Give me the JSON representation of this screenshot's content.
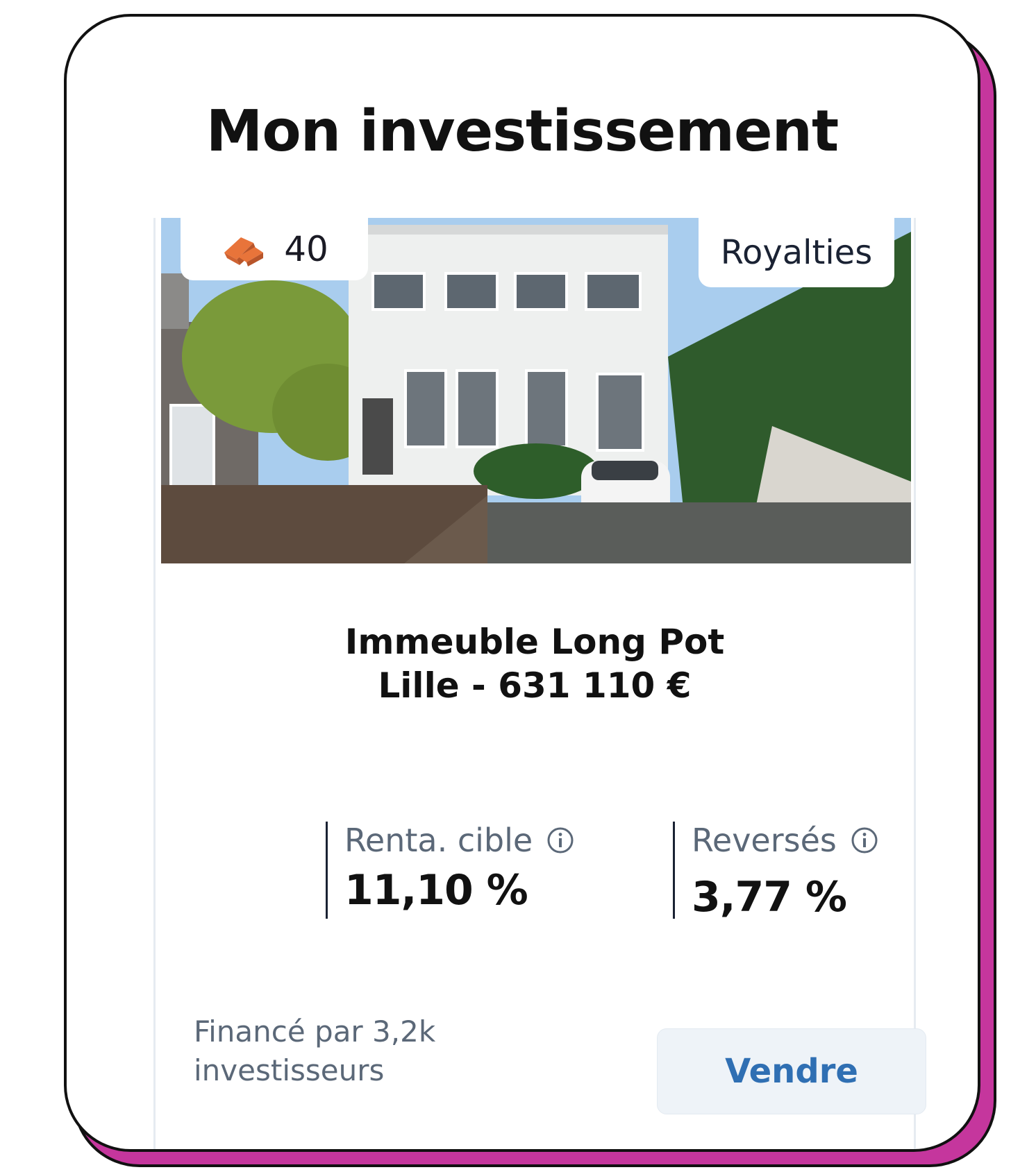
{
  "page": {
    "heading": "Mon investissement"
  },
  "property": {
    "brick_count": "40",
    "type_badge": "Royalties",
    "name": "Immeuble Long Pot",
    "location_price": "Lille - 631 110 €"
  },
  "metrics": {
    "target_return": {
      "label": "Renta. cible",
      "value": "11,10 %"
    },
    "paid_out": {
      "label": "Reversés",
      "value": "3,77 %"
    }
  },
  "footer": {
    "funded_by": "Financé par 3,2k investisseurs",
    "sell_label": "Vendre"
  },
  "colors": {
    "accent_shadow": "#c5369d",
    "button_text": "#2f6fb3",
    "button_bg": "#eef3f8"
  },
  "icons": [
    "brick-icon",
    "info-icon"
  ]
}
